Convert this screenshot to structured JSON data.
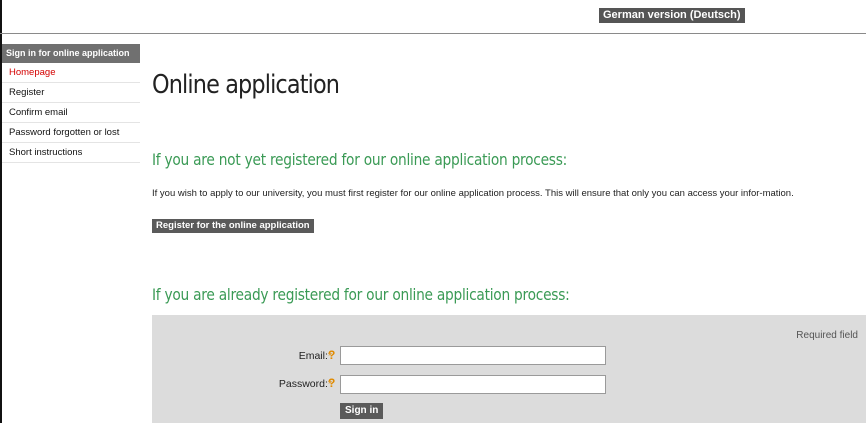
{
  "header": {
    "language_link": "German version (Deutsch)"
  },
  "sidebar": {
    "title": "Sign in for online application",
    "items": [
      {
        "label": "Homepage",
        "active": true
      },
      {
        "label": "Register"
      },
      {
        "label": "Confirm email"
      },
      {
        "label": "Password forgotten or lost"
      },
      {
        "label": "Short instructions"
      }
    ]
  },
  "main": {
    "title": "Online application",
    "not_registered_heading": "If you are not yet registered for our online application process:",
    "intro_text": "If you wish to apply to our university, you must first register for our online application process. This will ensure that only you can access your infor-mation.",
    "register_button": "Register for the online application",
    "registered_heading": "If you are already registered for our online application process:"
  },
  "form": {
    "required_note": "Required field",
    "email_label": "Email:",
    "password_label": "Password:",
    "required_marker": "*",
    "help_symbol": "?",
    "email_value": "",
    "password_value": "",
    "signin_button": "Sign in"
  },
  "colors": {
    "heading_green": "#3a9a55",
    "active_red": "#d40000",
    "required_orange": "#e08a00",
    "panel_gray": "#dcdcdc"
  }
}
